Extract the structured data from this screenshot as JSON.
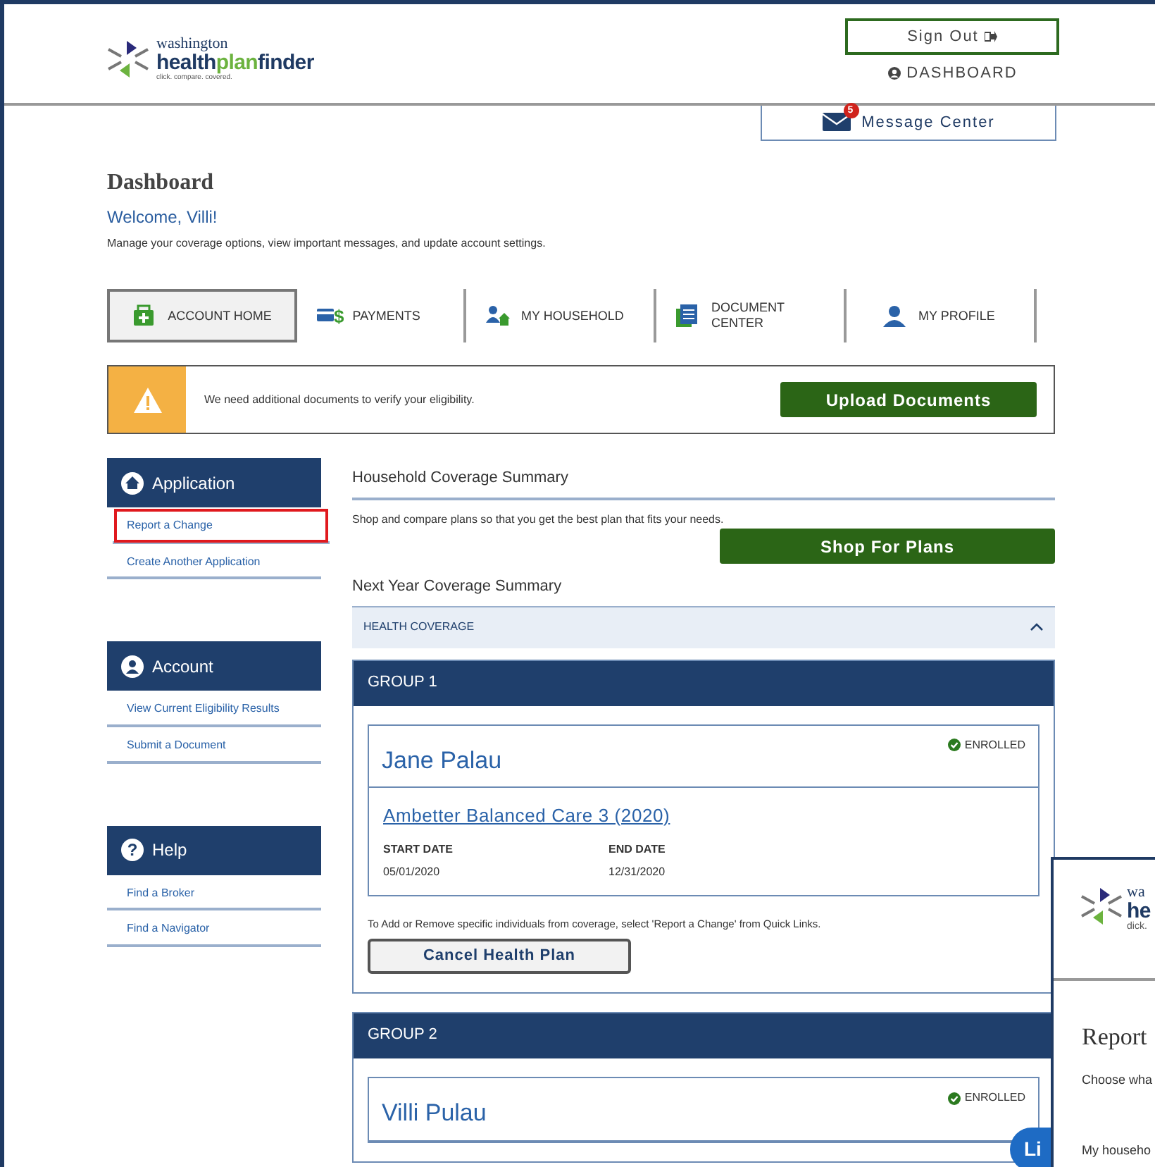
{
  "header": {
    "logo": {
      "top_line": "washington",
      "wordmark": [
        {
          "text": "health",
          "highlighted": false
        },
        {
          "text": "plan",
          "highlighted": true
        },
        {
          "text": "finder",
          "highlighted": false
        }
      ],
      "tagline": "click. compare. covered."
    },
    "sign_out": "Sign Out",
    "dashboard_link": "DASHBOARD",
    "message_center": {
      "label": "Message Center",
      "count": "5"
    }
  },
  "page": {
    "title": "Dashboard",
    "welcome": "Welcome, Villi!",
    "intro": "Manage your coverage options, view important messages, and update account settings."
  },
  "tabs": [
    {
      "kind": "home",
      "label": "ACCOUNT HOME",
      "selected": true
    },
    {
      "kind": "payments",
      "label": "PAYMENTS",
      "icon_glyph": "$",
      "selected": false
    },
    {
      "kind": "household",
      "label": "MY HOUSEHOLD",
      "selected": false
    },
    {
      "kind": "documents",
      "label": "DOCUMENT CENTER",
      "selected": false
    },
    {
      "kind": "profile",
      "label": "MY PROFILE",
      "selected": false
    }
  ],
  "alert": {
    "message": "We need additional documents to verify your eligibility.",
    "button": "Upload Documents"
  },
  "sidebar": [
    {
      "kind": "home",
      "title": "Application",
      "links": [
        {
          "label": "Report a Change",
          "highlighted": true
        },
        {
          "label": "Create Another Application",
          "highlighted": false
        }
      ]
    },
    {
      "kind": "account",
      "title": "Account",
      "links": [
        {
          "label": "View Current Eligibility Results",
          "highlighted": false
        },
        {
          "label": "Submit a Document",
          "highlighted": false
        }
      ]
    },
    {
      "kind": "help",
      "title": "Help",
      "icon_glyph": "?",
      "links": [
        {
          "label": "Find a Broker",
          "highlighted": false
        },
        {
          "label": "Find a Navigator",
          "highlighted": false
        }
      ]
    }
  ],
  "household": {
    "title": "Household Coverage Summary",
    "text": "Shop and compare plans so that you get the best plan that fits your needs.",
    "button": "Shop For Plans"
  },
  "next_year": {
    "title": "Next Year Coverage Summary",
    "section": "HEALTH COVERAGE",
    "expanded": true,
    "groups": [
      {
        "title": "GROUP 1",
        "member": "Jane Palau",
        "status": "ENROLLED",
        "plan": "Ambetter Balanced Care 3 (2020)",
        "start_label": "START DATE",
        "start": "05/01/2020",
        "end_label": "END DATE",
        "end": "12/31/2020",
        "note": "To Add or Remove specific individuals from coverage, select 'Report a Change' from Quick Links.",
        "button": "Cancel Health Plan"
      },
      {
        "title": "GROUP 2",
        "member": "Villi Pulau",
        "status": "ENROLLED"
      }
    ]
  },
  "chat_button": "Li",
  "overlay": {
    "logo_top": "wa",
    "logo_word": "he",
    "logo_tagline": "dick.",
    "title": "Report",
    "text": "Choose wha",
    "text_2": "My househo"
  }
}
